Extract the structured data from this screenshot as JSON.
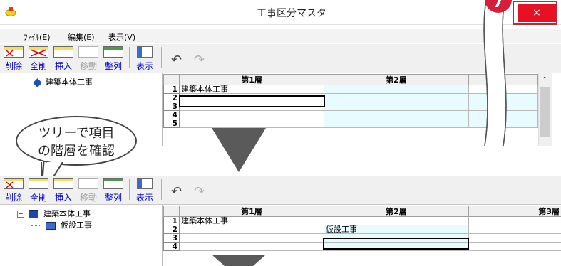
{
  "window1": {
    "title": "工事区分マスタ",
    "close_label": "×",
    "step_badge": "7",
    "menu": [
      "ﾌｧｲﾙ(E)",
      "編集(E)",
      "表示(V)"
    ],
    "toolbar": {
      "buttons": [
        "削除",
        "全削",
        "挿入",
        "移動",
        "整列",
        "表示"
      ],
      "undo_icon": "undo-icon",
      "redo_icon": "redo-icon"
    },
    "tree": {
      "root": "建築本体工事"
    },
    "grid": {
      "headers": [
        "第1層",
        "第2層"
      ],
      "rows": [
        {
          "n": "1",
          "c1": "建築本体工事",
          "c2": ""
        },
        {
          "n": "2",
          "c1": "",
          "c2": ""
        },
        {
          "n": "3",
          "c1": "",
          "c2": ""
        },
        {
          "n": "4",
          "c1": "",
          "c2": ""
        },
        {
          "n": "5",
          "c1": "",
          "c2": ""
        }
      ]
    }
  },
  "callout": {
    "line1": "ツリーで項目",
    "line2": "の階層を確認"
  },
  "window2": {
    "toolbar": {
      "buttons": [
        "削除",
        "全削",
        "挿入",
        "移動",
        "整列",
        "表示"
      ]
    },
    "tree": {
      "root": "建築本体工事",
      "child": "仮設工事",
      "expander": "−"
    },
    "grid": {
      "headers": [
        "第1層",
        "第2層",
        "第3層"
      ],
      "rows": [
        {
          "n": "1",
          "c1": "建築本体工事",
          "c2": ""
        },
        {
          "n": "2",
          "c1": "",
          "c2": "仮設工事"
        },
        {
          "n": "3",
          "c1": "",
          "c2": ""
        },
        {
          "n": "4",
          "c1": "",
          "c2": ""
        }
      ]
    }
  },
  "colors": {
    "close": "#e81123",
    "badge": "#d4203a",
    "cyan_column": "#e8fbff",
    "toolbar_label": "#0000d0"
  }
}
